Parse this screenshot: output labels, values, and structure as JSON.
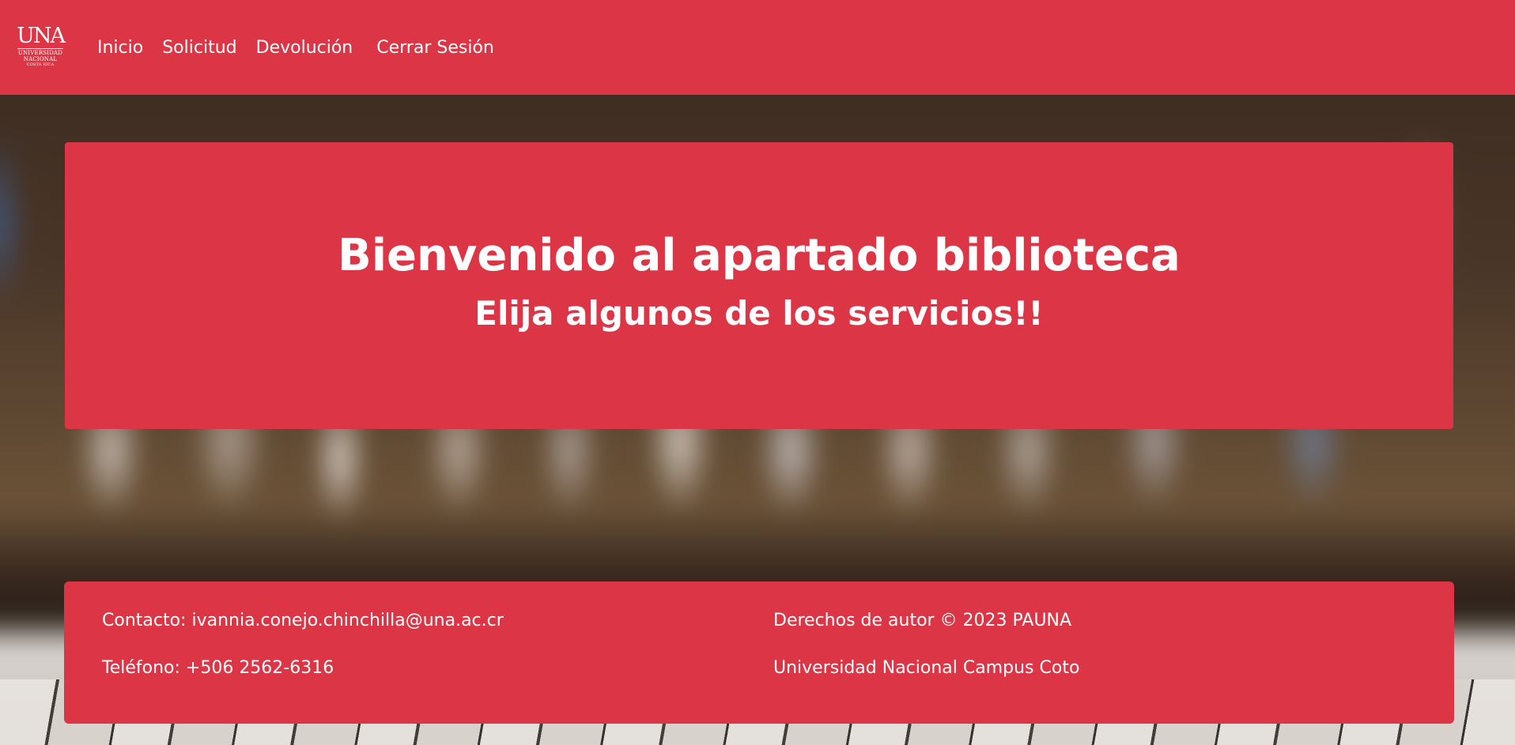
{
  "header": {
    "logo": {
      "text": "UNA",
      "line1": "UNIVERSIDAD",
      "line2": "NACIONAL",
      "line3": "COSTA RICA"
    },
    "nav": {
      "inicio": "Inicio",
      "solicitud": "Solicitud",
      "devolucion": "Devolución",
      "cerrar_sesion": "Cerrar Sesión"
    }
  },
  "hero": {
    "title": "Bienvenido al apartado biblioteca",
    "subtitle": "Elija algunos de los servicios!!"
  },
  "footer": {
    "contact": "Contacto: ivannia.conejo.chinchilla@una.ac.cr",
    "phone": "Teléfono: +506 2562-6316",
    "copyright": "Derechos de autor © 2023 PAUNA",
    "campus": "Universidad Nacional Campus Coto"
  },
  "colors": {
    "primary": "#dc3545",
    "text": "#ffffff"
  }
}
